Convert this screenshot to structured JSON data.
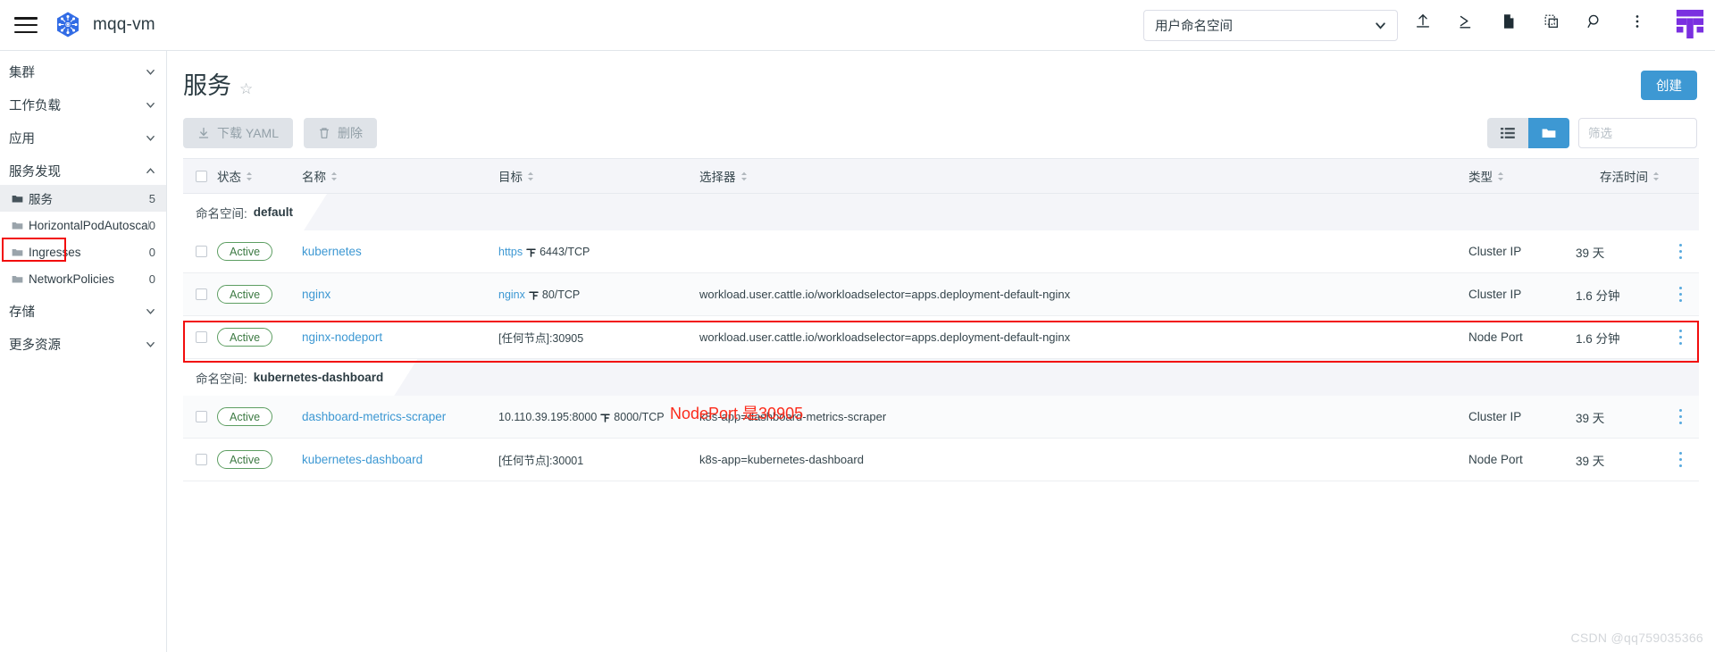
{
  "topbar": {
    "menu_icon": "hamburger-icon",
    "logo_icon": "kubernetes-logo",
    "cluster_name": "mqq-vm",
    "namespace_select": {
      "value": "用户命名空间",
      "chevron": "chevron-down-icon"
    },
    "icons": [
      "upload-icon",
      "terminal-icon",
      "file-icon",
      "copy-icon",
      "search-icon",
      "kebab-menu-icon"
    ],
    "brand_logo": "rancher-logo"
  },
  "sidebar": {
    "groups": [
      {
        "label": "集群",
        "expanded": false
      },
      {
        "label": "工作负载",
        "expanded": false
      },
      {
        "label": "应用",
        "expanded": false
      },
      {
        "label": "服务发现",
        "expanded": true
      }
    ],
    "items": [
      {
        "label": "服务",
        "count": "5",
        "active": true
      },
      {
        "label": "HorizontalPodAutoscalers",
        "count": "0",
        "active": false
      },
      {
        "label": "Ingresses",
        "count": "0",
        "active": false
      },
      {
        "label": "NetworkPolicies",
        "count": "0",
        "active": false
      }
    ],
    "groups_bottom": [
      {
        "label": "存储",
        "expanded": false
      },
      {
        "label": "更多资源",
        "expanded": false
      }
    ]
  },
  "main": {
    "title": "服务",
    "favorite_icon": "star-icon",
    "create_button": "创建",
    "download_yaml_button": "下载 YAML",
    "delete_button": "删除",
    "view_list_icon": "list-view-icon",
    "view_group_icon": "folder-view-icon",
    "filter_placeholder": "筛选"
  },
  "table": {
    "headers": [
      {
        "label": "状态"
      },
      {
        "label": "名称"
      },
      {
        "label": "目标"
      },
      {
        "label": "选择器"
      },
      {
        "label": "类型"
      },
      {
        "label": "存活时间"
      }
    ],
    "groups": [
      {
        "group_key": "命名空间:",
        "group_value": "default",
        "rows": [
          {
            "status": "Active",
            "name": "kubernetes",
            "target_link": "https",
            "target_rest": "6443/TCP",
            "selector": "",
            "type": "Cluster IP",
            "age": "39 天"
          },
          {
            "status": "Active",
            "name": "nginx",
            "target_link": "nginx",
            "target_rest": "80/TCP",
            "selector": "workload.user.cattle.io/workloadselector=apps.deployment-default-nginx",
            "type": "Cluster IP",
            "age": "1.6 分钟"
          },
          {
            "status": "Active",
            "name": "nginx-nodeport",
            "target_link": "",
            "target_rest": "[任何节点]:30905",
            "selector": "workload.user.cattle.io/workloadselector=apps.deployment-default-nginx",
            "type": "Node Port",
            "age": "1.6 分钟"
          }
        ]
      },
      {
        "group_key": "命名空间:",
        "group_value": "kubernetes-dashboard",
        "rows": [
          {
            "status": "Active",
            "name": "dashboard-metrics-scraper",
            "target_link": "",
            "target_rest": "10.110.39.195:8000",
            "target_port": "8000/TCP",
            "selector": "k8s-app=dashboard-metrics-scraper",
            "type": "Cluster IP",
            "age": "39 天"
          },
          {
            "status": "Active",
            "name": "kubernetes-dashboard",
            "target_link": "",
            "target_rest": "[任何节点]:30001",
            "selector": "k8s-app=kubernetes-dashboard",
            "type": "Node Port",
            "age": "39 天"
          }
        ]
      }
    ]
  },
  "annotations": {
    "nodeport_note": "NodePort 是30905",
    "highlight_color": "#f20d0d",
    "note_color": "#fb2b1b"
  },
  "watermark": "CSDN @qq759035366"
}
